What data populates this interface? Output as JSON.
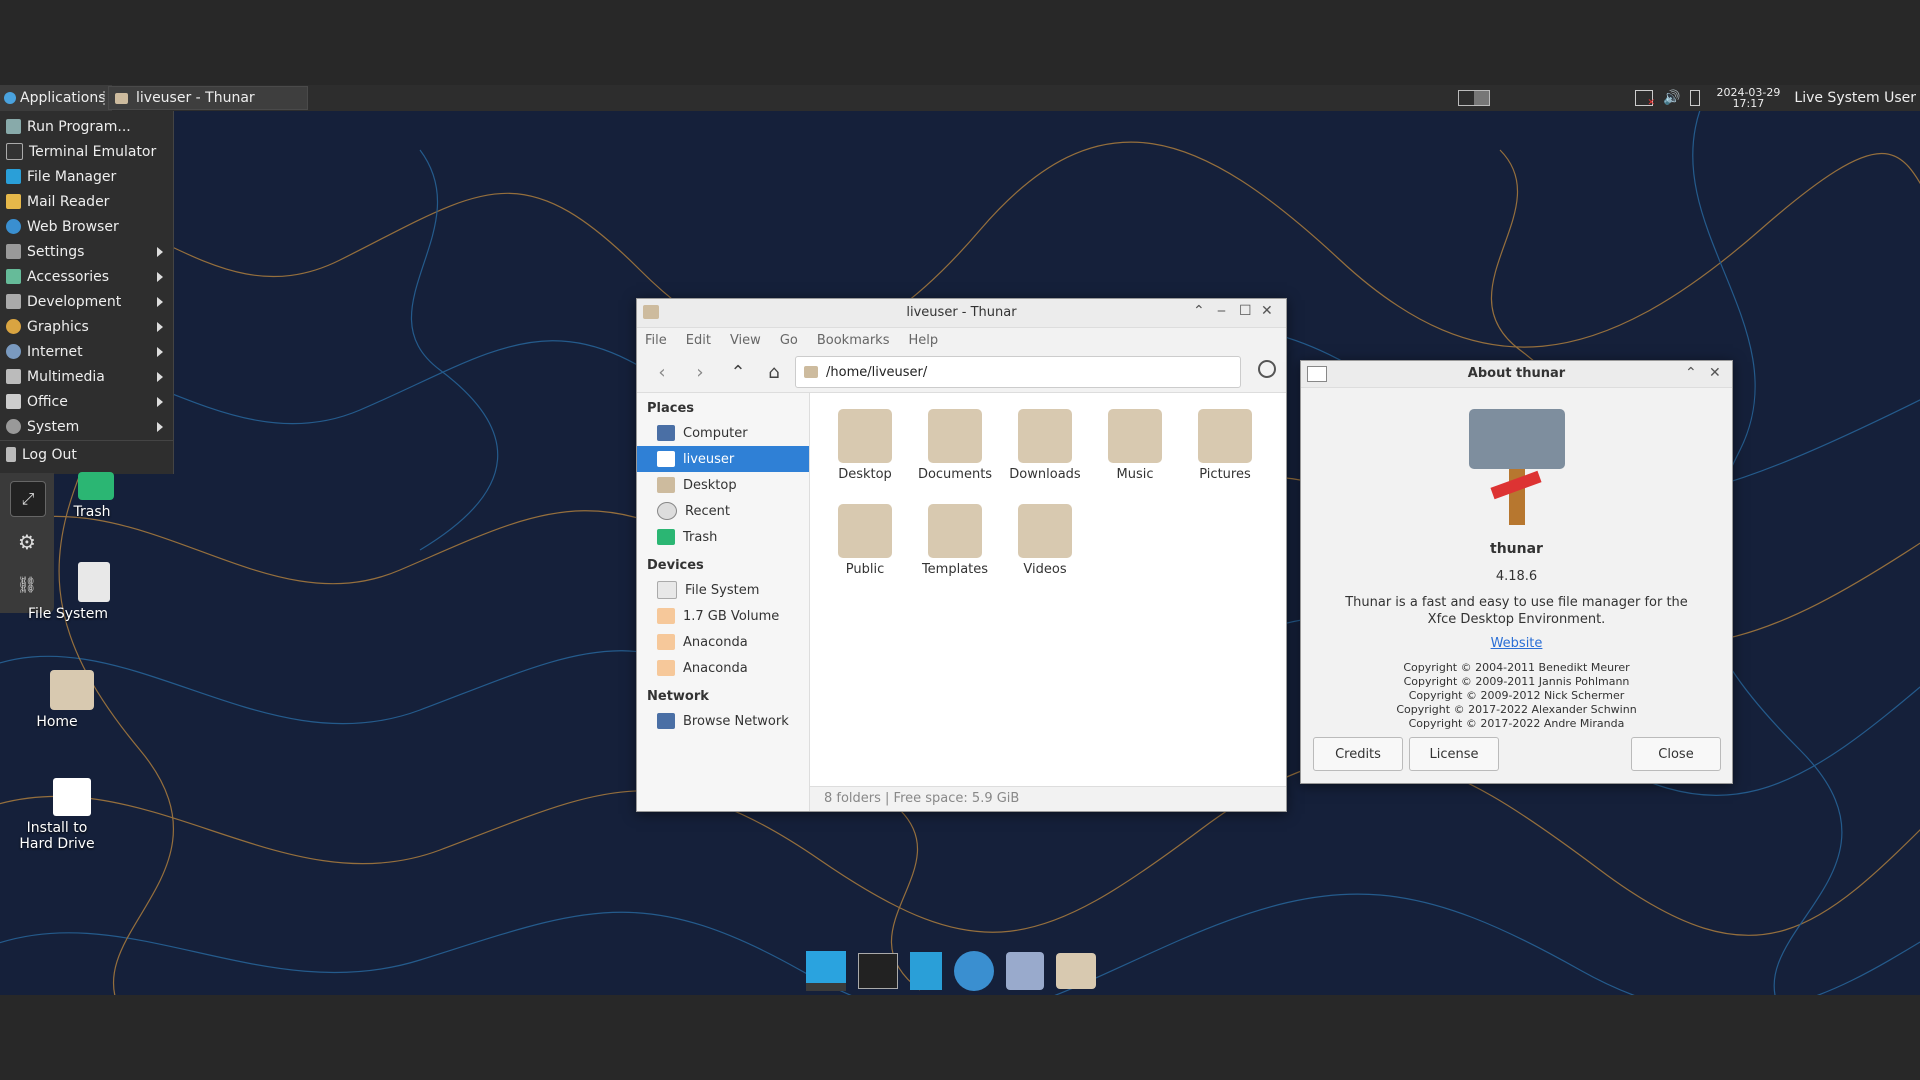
{
  "panel": {
    "apps_label": "Applications",
    "task_label": "liveuser - Thunar",
    "clock_date": "2024-03-29",
    "clock_time": "17:17",
    "user_label": "Live System User"
  },
  "app_menu": {
    "items": [
      {
        "label": "Run Program...",
        "icon": "run-icon"
      },
      {
        "label": "Terminal Emulator",
        "icon": "terminal-icon"
      },
      {
        "label": "File Manager",
        "icon": "file-manager-icon"
      },
      {
        "label": "Mail Reader",
        "icon": "mail-icon"
      },
      {
        "label": "Web Browser",
        "icon": "web-browser-icon"
      },
      {
        "label": "Settings",
        "icon": "settings-icon"
      },
      {
        "label": "Accessories",
        "icon": "accessories-icon"
      },
      {
        "label": "Development",
        "icon": "development-icon"
      },
      {
        "label": "Graphics",
        "icon": "graphics-icon"
      },
      {
        "label": "Internet",
        "icon": "internet-icon"
      },
      {
        "label": "Multimedia",
        "icon": "multimedia-icon"
      },
      {
        "label": "Office",
        "icon": "office-icon"
      },
      {
        "label": "System",
        "icon": "system-icon"
      },
      {
        "label": "Log Out",
        "icon": "logout-icon"
      }
    ]
  },
  "desktop_icons": {
    "trash": "Trash",
    "filesystem": "File System",
    "home": "Home",
    "install": "Install to\nHard Drive"
  },
  "thunar": {
    "title": "liveuser - Thunar",
    "menus": [
      "File",
      "Edit",
      "View",
      "Go",
      "Bookmarks",
      "Help"
    ],
    "path": "/home/liveuser/",
    "places_header": "Places",
    "places": [
      "Computer",
      "liveuser",
      "Desktop",
      "Recent",
      "Trash"
    ],
    "devices_header": "Devices",
    "devices": [
      "File System",
      "1.7 GB Volume",
      "Anaconda",
      "Anaconda"
    ],
    "network_header": "Network",
    "network": [
      "Browse Network"
    ],
    "folders": [
      "Desktop",
      "Documents",
      "Downloads",
      "Music",
      "Pictures",
      "Public",
      "Templates",
      "Videos"
    ],
    "status": "8 folders  |  Free space: 5.9 GiB"
  },
  "about": {
    "title": "About thunar",
    "name": "thunar",
    "version": "4.18.6",
    "description": "Thunar is a fast and easy to use file manager for the Xfce Desktop Environment.",
    "website": "Website",
    "copyrights": [
      "Copyright © 2004-2011 Benedikt Meurer",
      "Copyright © 2009-2011 Jannis Pohlmann",
      "Copyright © 2009-2012 Nick Schermer",
      "Copyright © 2017-2022 Alexander Schwinn",
      "Copyright © 2017-2022 Andre Miranda"
    ],
    "credits_label": "Credits",
    "license_label": "License",
    "close_label": "Close"
  },
  "colors": {
    "desktop_bg": "#15203a",
    "accent": "#2f80d6",
    "folder": "#d8c9b0"
  }
}
